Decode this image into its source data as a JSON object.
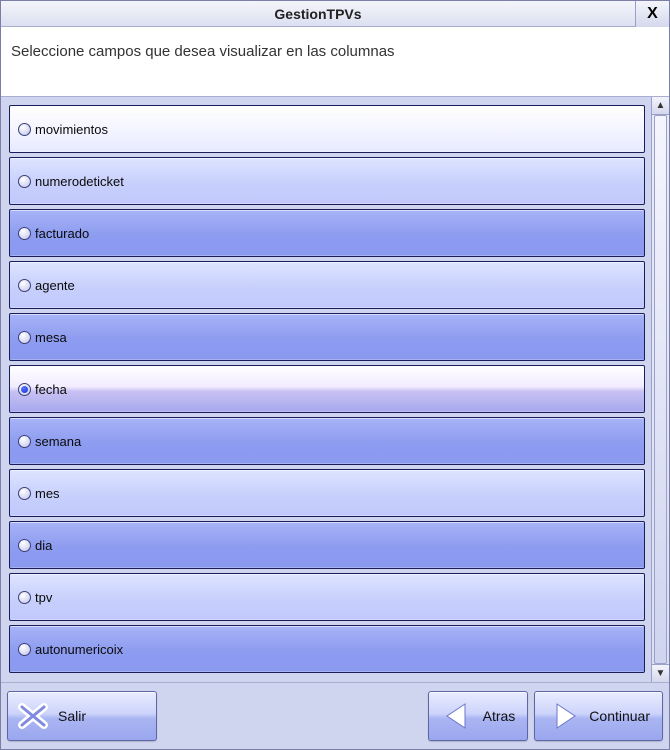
{
  "window": {
    "title": "GestionTPVs",
    "close_label": "X"
  },
  "instruction": "Seleccione campos que desea visualizar en las columnas",
  "list": {
    "items": [
      {
        "label": "movimientos",
        "selected": false,
        "variant": 0
      },
      {
        "label": "numerodeticket",
        "selected": false,
        "variant": 1
      },
      {
        "label": "facturado",
        "selected": false,
        "variant": 2
      },
      {
        "label": "agente",
        "selected": false,
        "variant": 1
      },
      {
        "label": "mesa",
        "selected": false,
        "variant": 2
      },
      {
        "label": "fecha",
        "selected": true,
        "variant": 0
      },
      {
        "label": "semana",
        "selected": false,
        "variant": 2
      },
      {
        "label": "mes",
        "selected": false,
        "variant": 1
      },
      {
        "label": "dia",
        "selected": false,
        "variant": 2
      },
      {
        "label": "tpv",
        "selected": false,
        "variant": 1
      },
      {
        "label": "autonumericoix",
        "selected": false,
        "variant": 2
      }
    ]
  },
  "buttons": {
    "exit": "Salir",
    "back": "Atras",
    "next": "Continuar"
  },
  "scroll": {
    "up_glyph": "▲",
    "down_glyph": "▼"
  }
}
